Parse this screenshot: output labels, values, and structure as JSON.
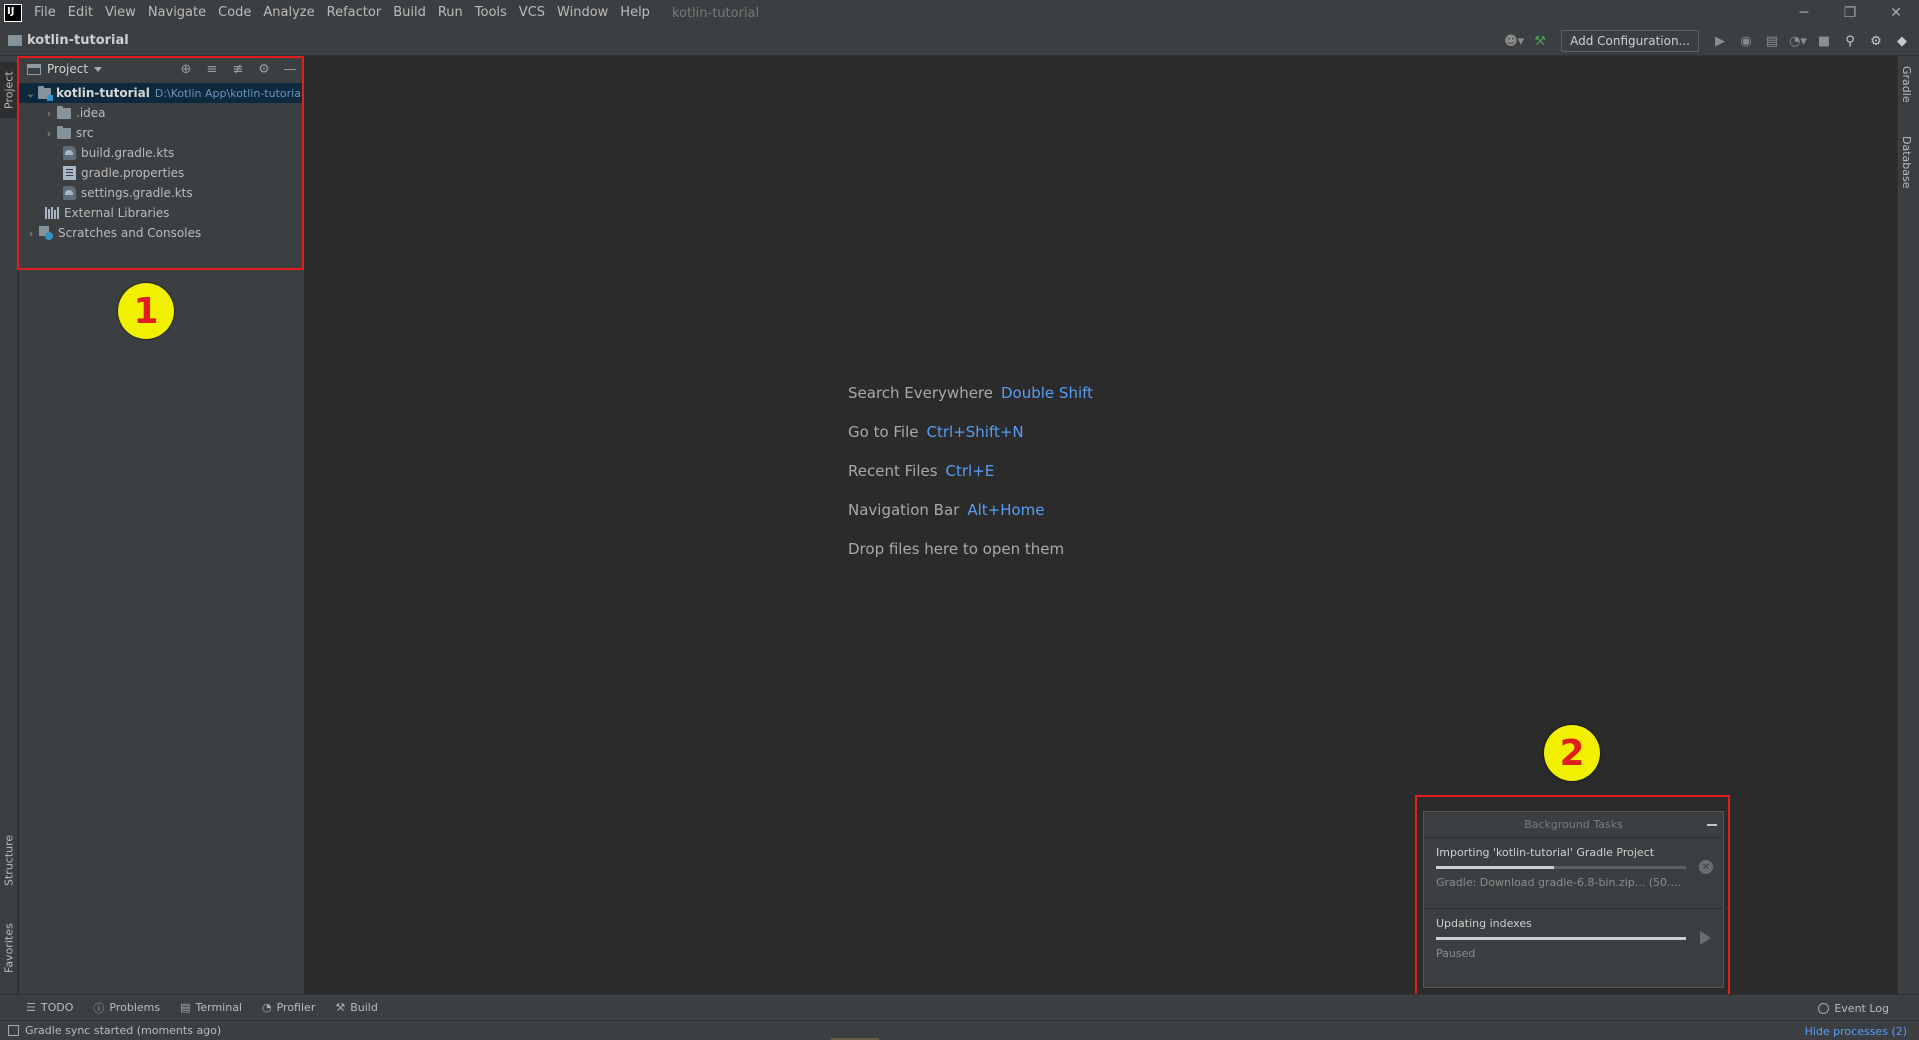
{
  "window": {
    "title": "kotlin-tutorial",
    "controls": {
      "minimize": "─",
      "restore": "❐",
      "close": "✕"
    }
  },
  "menu": [
    "File",
    "Edit",
    "View",
    "Navigate",
    "Code",
    "Analyze",
    "Refactor",
    "Build",
    "Run",
    "Tools",
    "VCS",
    "Window",
    "Help"
  ],
  "navbar": {
    "project": "kotlin-tutorial",
    "add_configuration": "Add Configuration...",
    "icons": [
      "user-icon",
      "hammer-icon",
      "run-icon",
      "debug-icon",
      "coverage-icon",
      "profile-icon",
      "stop-icon",
      "search-icon",
      "gear-icon",
      "toolbox-icon"
    ]
  },
  "left_stripe": {
    "project": "Project",
    "structure": "Structure",
    "favorites": "Favorites"
  },
  "right_stripe": {
    "gradle": "Gradle",
    "database": "Database"
  },
  "project_panel": {
    "title": "Project",
    "tree": {
      "root_name": "kotlin-tutorial",
      "root_path": "D:\\Kotlin App\\kotlin-tutorial",
      "idea": ".idea",
      "src": "src",
      "build_gradle": "build.gradle.kts",
      "gradle_properties": "gradle.properties",
      "settings_gradle": "settings.gradle.kts",
      "external_libraries": "External Libraries",
      "scratches": "Scratches and Consoles"
    }
  },
  "annotations": {
    "one": "1",
    "two": "2"
  },
  "editor_hints": {
    "search_label": "Search Everywhere",
    "search_key": "Double Shift",
    "goto_label": "Go to File",
    "goto_key": "Ctrl+Shift+N",
    "recent_label": "Recent Files",
    "recent_key": "Ctrl+E",
    "navbar_label": "Navigation Bar",
    "navbar_key": "Alt+Home",
    "drop_label": "Drop files here to open them"
  },
  "background_tasks": {
    "title": "Background Tasks",
    "task1": {
      "title": "Importing 'kotlin-tutorial' Gradle Project",
      "progress": 0.47,
      "status": "Gradle: Download gradle-6.8-bin.zip... (50...."
    },
    "task2": {
      "title": "Updating indexes",
      "progress": 1.0,
      "status": "Paused"
    }
  },
  "tool_windows": {
    "todo": "TODO",
    "problems": "Problems",
    "terminal": "Terminal",
    "profiler": "Profiler",
    "build": "Build",
    "event_log": "Event Log"
  },
  "status": {
    "message": "Gradle sync started (moments ago)",
    "hide_processes": "Hide processes (2)"
  },
  "colors": {
    "accent": "#589df6",
    "annotation_red": "#e01e1e",
    "annotation_yellow": "#f0f000"
  }
}
